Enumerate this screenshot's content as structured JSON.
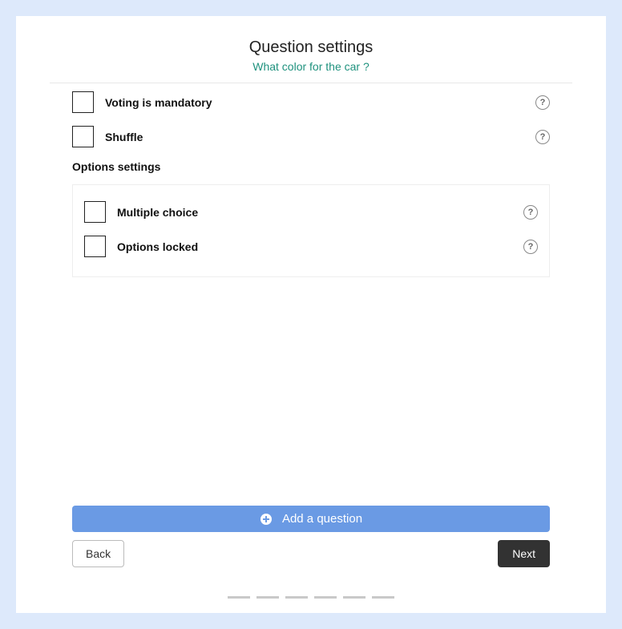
{
  "header": {
    "title": "Question settings",
    "subtitle": "What color for the car ?"
  },
  "settings": [
    {
      "label": "Voting is mandatory"
    },
    {
      "label": "Shuffle"
    }
  ],
  "options_section": {
    "heading": "Options settings",
    "items": [
      {
        "label": "Multiple choice"
      },
      {
        "label": "Options locked"
      }
    ]
  },
  "footer": {
    "add_label": "Add a question",
    "back_label": "Back",
    "next_label": "Next"
  },
  "help_glyph": "?"
}
